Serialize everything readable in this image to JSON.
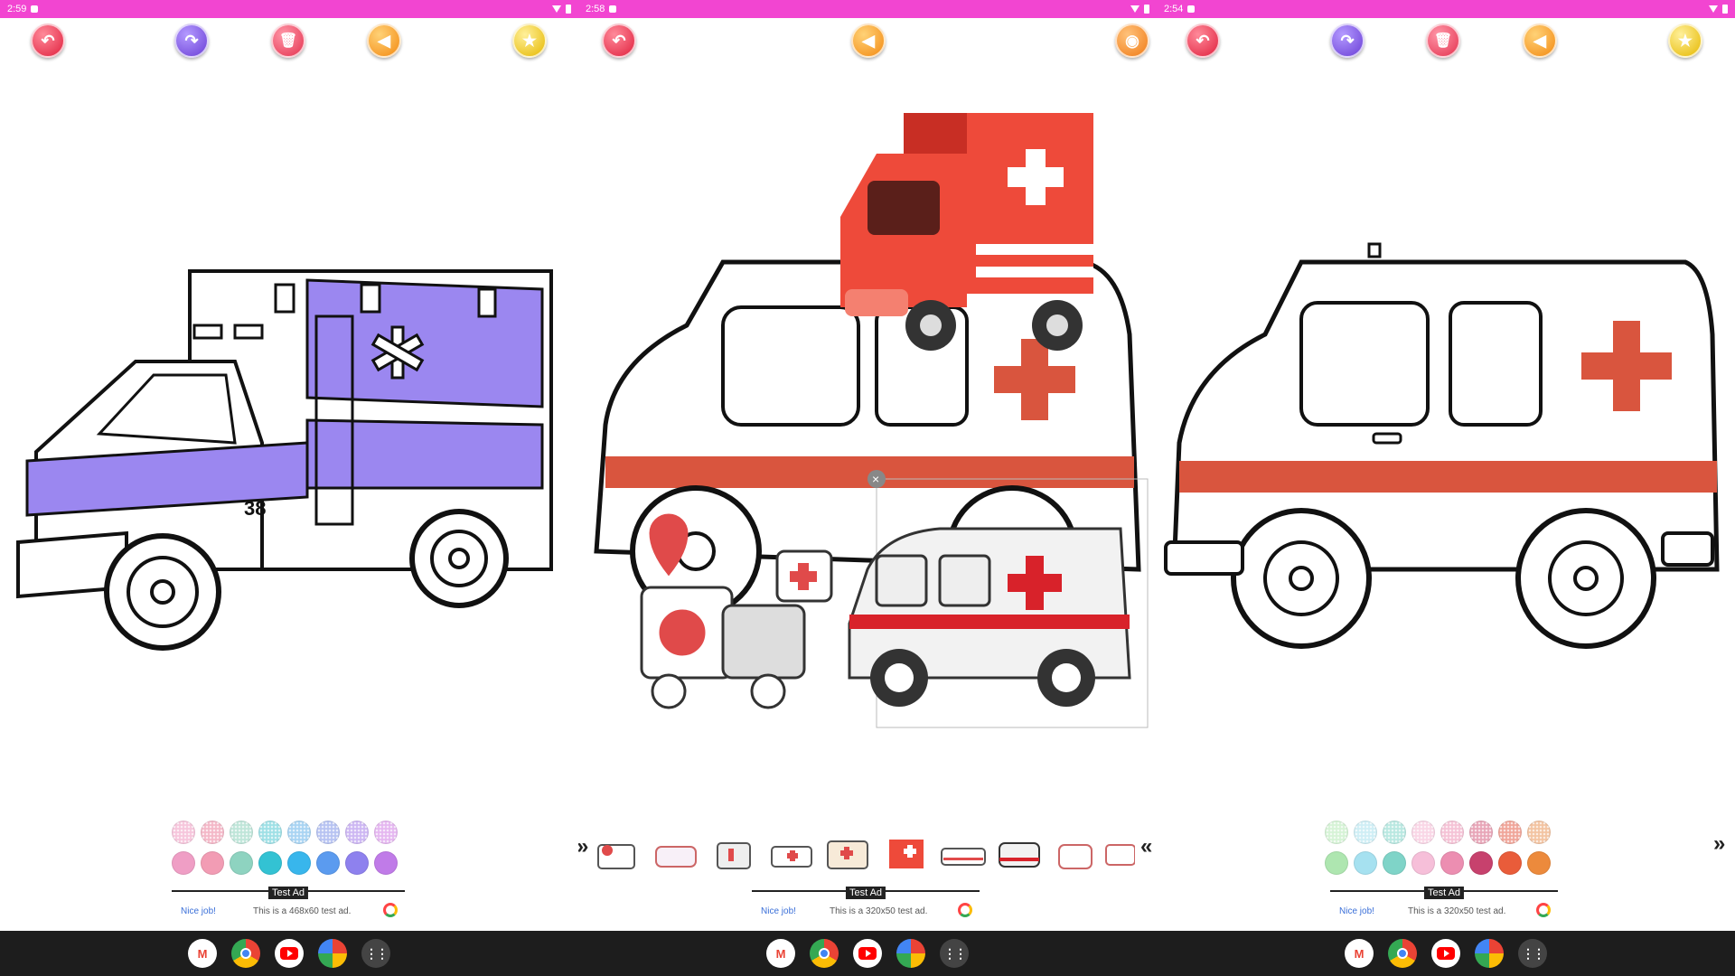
{
  "panels": [
    {
      "id": "p1",
      "status": {
        "time": "2:59"
      },
      "tools": [
        "undo",
        "redo",
        "trash",
        "sound",
        "save"
      ],
      "ad": {
        "label": "Test Ad",
        "nice": "Nice job!",
        "text": "This is a 468x60 test ad."
      },
      "palette_top": [
        "#f6c6dc",
        "#f4b8c8",
        "#bfe5d9",
        "#9fe0e6",
        "#a9d4f3",
        "#b7c3f2",
        "#cdb7f3",
        "#e5b7f0"
      ],
      "palette_bottom": [
        "#ef9ec5",
        "#f29cb4",
        "#8ed3c0",
        "#33c2d3",
        "#38b6ec",
        "#5b9bef",
        "#8e81ee",
        "#c07be8"
      ],
      "fill_color": "#9b87f0",
      "stripe_color": "#9b87f0",
      "vehicle_number": "38"
    },
    {
      "id": "p2",
      "status": {
        "time": "2:58"
      },
      "tools": [
        "undo",
        "sound",
        "camera"
      ],
      "ad": {
        "label": "Test Ad",
        "nice": "Nice job!",
        "text": "This is a 320x50 test ad."
      },
      "stripe_color": "#d9553e",
      "truck_color": "#ee4a3a",
      "left_arrow": "»",
      "right_arrow": "«"
    },
    {
      "id": "p3",
      "status": {
        "time": "2:54"
      },
      "tools": [
        "undo",
        "redo",
        "trash",
        "sound",
        "save"
      ],
      "ad": {
        "label": "Test Ad",
        "nice": "Nice job!",
        "text": "This is a 320x50 test ad."
      },
      "palette_top": [
        "#d6f3d6",
        "#cfeef5",
        "#b9e8e1",
        "#f9d6e6",
        "#f5c3d6",
        "#e8a6b8",
        "#f0a69a",
        "#f3c4a2"
      ],
      "palette_bottom": [
        "#aee6b0",
        "#a6e1f0",
        "#7fd4c8",
        "#f6bfd9",
        "#ec8eb1",
        "#c7416d",
        "#e95c3a",
        "#ec8a3c"
      ],
      "stripe_color": "#d9553e",
      "right_arrow": "»"
    }
  ],
  "icons": {
    "undo": "↶",
    "redo": "↷",
    "trash": "🗑",
    "sound": "◀",
    "save": "★",
    "camera": "◉"
  }
}
